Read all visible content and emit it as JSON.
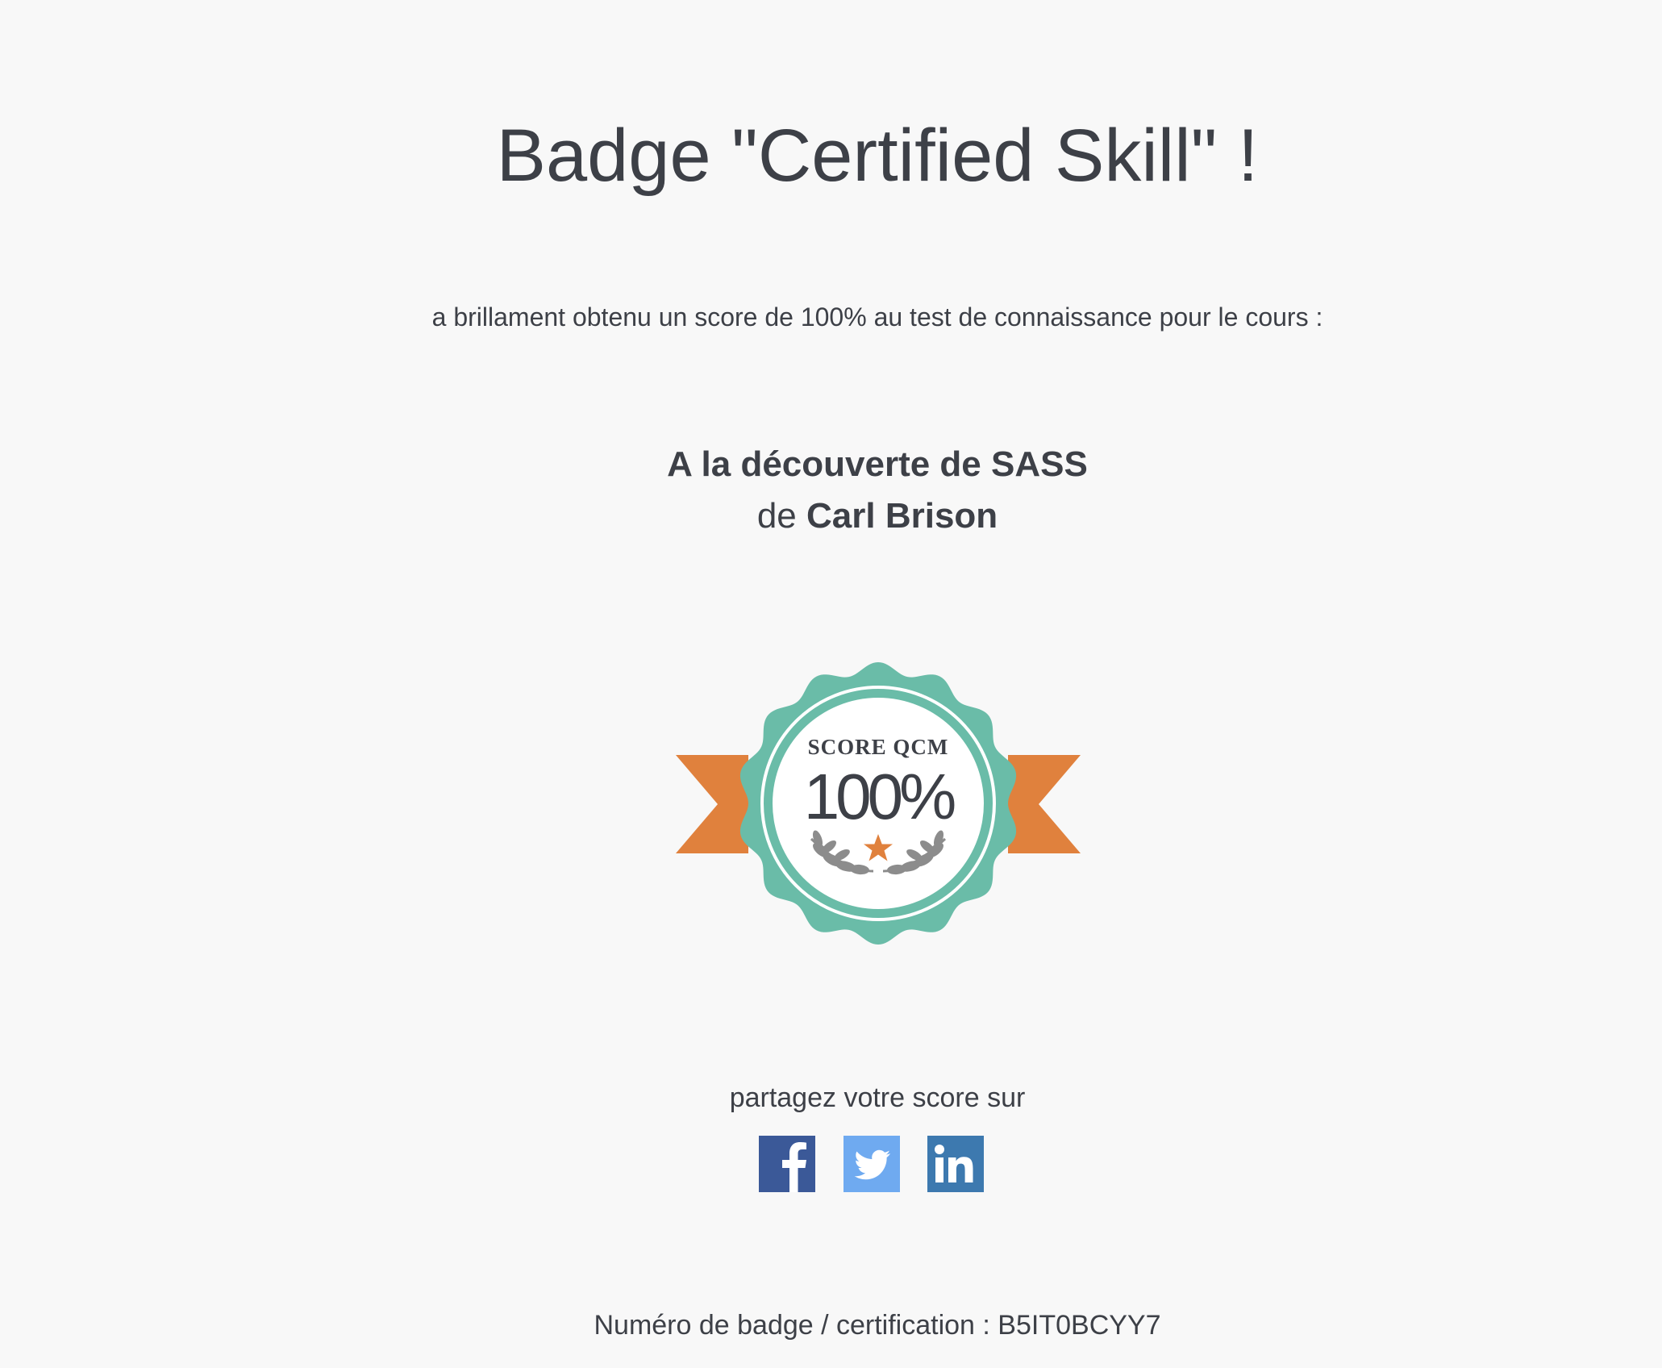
{
  "header": {
    "title": "Badge \"Certified Skill\" !"
  },
  "intro": {
    "text": "a brillament obtenu un score de 100% au test de connaissance pour le cours :"
  },
  "course": {
    "title": "A la découverte de SASS",
    "author_prefix": "de",
    "author": "Carl Brison"
  },
  "badge": {
    "label": "SCORE QCM",
    "score": "100%",
    "colors": {
      "seal": "#6abca8",
      "ribbon": "#e0813d",
      "text": "#3d4047",
      "laurel": "#8c8c8c",
      "star": "#e0813d"
    }
  },
  "share": {
    "label": "partagez votre score sur",
    "networks": [
      {
        "name": "facebook",
        "icon": "facebook-icon",
        "color": "#3b5998"
      },
      {
        "name": "twitter",
        "icon": "twitter-icon",
        "color": "#6faaf0"
      },
      {
        "name": "linkedin",
        "icon": "linkedin-icon",
        "color": "#3d79af"
      }
    ]
  },
  "footer": {
    "badge_number": "Numéro de badge / certification : B5IT0BCYY7"
  }
}
